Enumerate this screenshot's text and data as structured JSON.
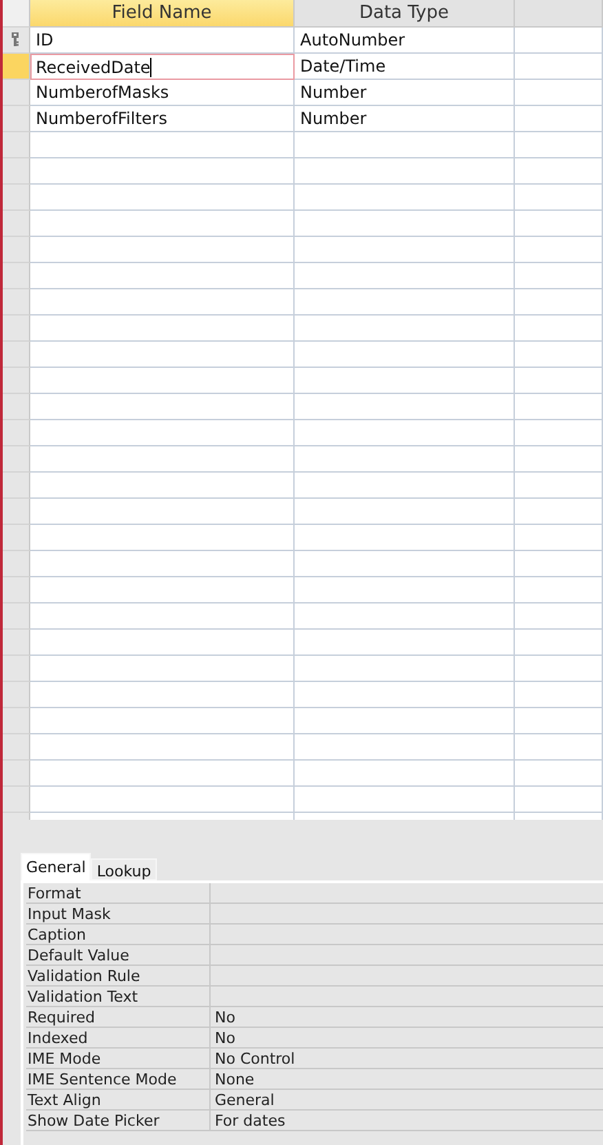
{
  "table": {
    "columns": [
      {
        "label": "Field Name",
        "selected": true
      },
      {
        "label": "Data Type",
        "selected": false
      }
    ],
    "rows": [
      {
        "field_name": "ID",
        "data_type": "AutoNumber",
        "primary_key": true,
        "selected": false
      },
      {
        "field_name": "ReceivedDate",
        "data_type": "Date/Time",
        "primary_key": false,
        "selected": true
      },
      {
        "field_name": "NumberofMasks",
        "data_type": "Number",
        "primary_key": false,
        "selected": false
      },
      {
        "field_name": "NumberofFilters",
        "data_type": "Number",
        "primary_key": false,
        "selected": false
      }
    ]
  },
  "properties": {
    "tabs": [
      {
        "label": "General",
        "selected": true
      },
      {
        "label": "Lookup",
        "selected": false
      }
    ],
    "items": [
      {
        "label": "Format"
      },
      {
        "label": "Input Mask"
      },
      {
        "label": "Caption"
      },
      {
        "label": "Default Value"
      },
      {
        "label": "Validation Rule"
      },
      {
        "label": "Validation Text"
      },
      {
        "label": "Required",
        "value": "No"
      },
      {
        "label": "Indexed",
        "value": "No"
      },
      {
        "label": "IME Mode",
        "value": "No Control"
      },
      {
        "label": "IME Sentence Mode",
        "value": "None"
      },
      {
        "label": "Text Align",
        "value": "General"
      },
      {
        "label": "Show Date Picker",
        "value": "For dates"
      }
    ]
  }
}
